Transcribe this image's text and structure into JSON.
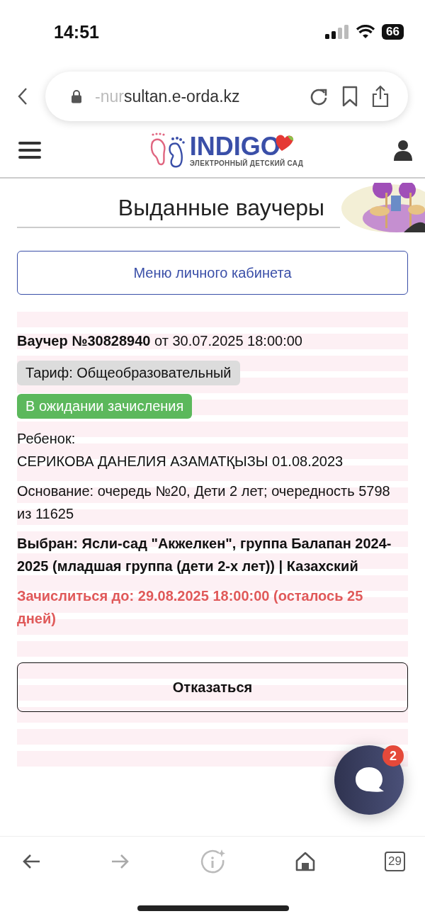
{
  "status_bar": {
    "time": "14:51",
    "battery": "66"
  },
  "browser": {
    "url_prefix": "-nur",
    "url_rest": "sultan.e-orda.kz"
  },
  "site_header": {
    "logo_title": "INDIGO",
    "logo_subtitle": "ЭЛЕКТРОННЫЙ ДЕТСКИЙ САД"
  },
  "page_title": "Выданные ваучеры",
  "menu_button": "Меню личного кабинета",
  "voucher": {
    "heading": "**Ваучер №30828940** от 30.07.2025 18:00:00",
    "tariff": "Тариф: Общеобразовательный",
    "status": "В ожидании зачисления",
    "child_label": "Ребенок:",
    "child": "СЕРИКОВА ДАНЕЛИЯ АЗАМАТҚЫЗЫ 01.08.2023",
    "basis": "Основание: очередь №20, Дети 2 лет; очередность 5798 из 11625",
    "chosen": "Выбран: Ясли-сад \"Акжелкен\", группа Балапан 2024-2025 (младшая группа (дети 2-х лет)) | Казахский",
    "deadline": "Зачислиться до: 29.08.2025 18:00:00 (осталось 25 дней)",
    "decline_button": "Отказаться"
  },
  "chat": {
    "badge": "2"
  },
  "bottom_bar": {
    "tabs_count": "29"
  }
}
